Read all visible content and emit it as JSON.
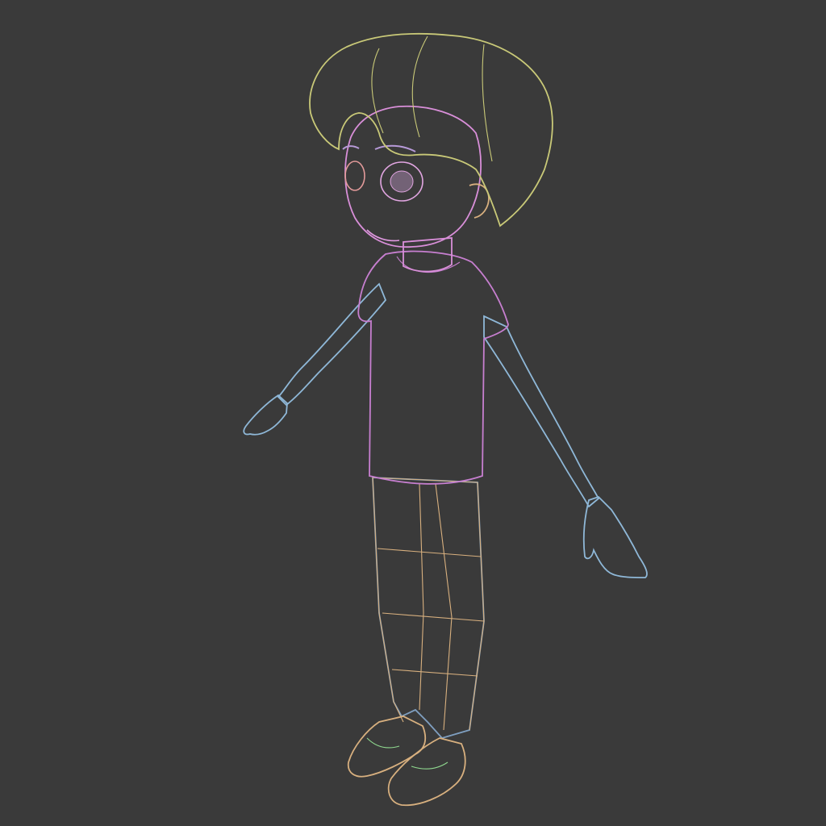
{
  "scene": {
    "background_color": "#3a3a3a",
    "subject": "wireframe-character-model",
    "mesh_groups": [
      {
        "name": "hair",
        "color": "#c9c978"
      },
      {
        "name": "head-skin",
        "color": "#d98fd9"
      },
      {
        "name": "shirt",
        "color": "#c77fd0"
      },
      {
        "name": "arms",
        "color": "#8fb8d8"
      },
      {
        "name": "pants",
        "color": "#7f9fc0"
      },
      {
        "name": "pants-cage",
        "color": "#d8b07f"
      },
      {
        "name": "shoes",
        "color": "#d8b07f"
      },
      {
        "name": "shoe-detail",
        "color": "#8fd88f"
      }
    ]
  }
}
